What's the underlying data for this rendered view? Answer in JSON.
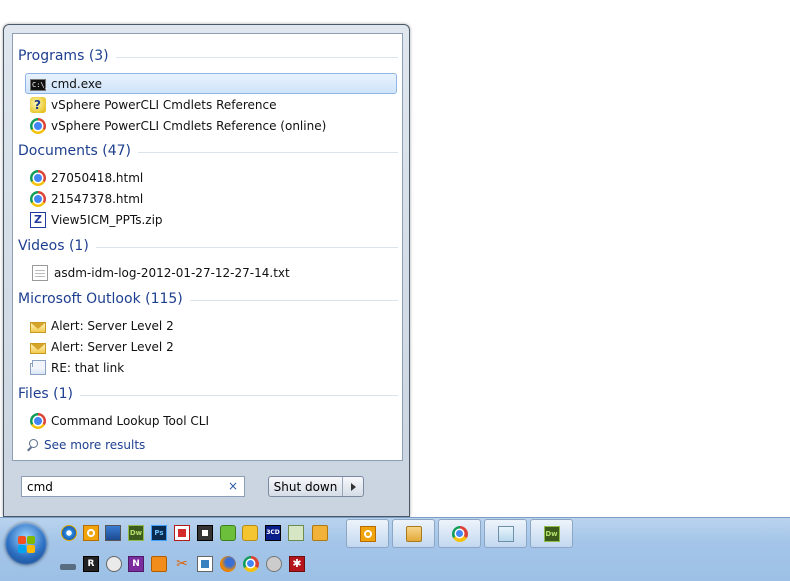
{
  "startmenu": {
    "groups": [
      {
        "title": "Programs (3)",
        "items": [
          {
            "label": "cmd.exe",
            "icon": "cmd-icon",
            "selected": true
          },
          {
            "label": "vSphere PowerCLI Cmdlets Reference",
            "icon": "help-file-icon"
          },
          {
            "label": "vSphere PowerCLI Cmdlets Reference (online)",
            "icon": "chrome-icon"
          }
        ]
      },
      {
        "title": "Documents (47)",
        "items": [
          {
            "label": "27050418.html",
            "icon": "chrome-icon"
          },
          {
            "label": "21547378.html",
            "icon": "chrome-icon"
          },
          {
            "label": "View5ICM_PPTs.zip",
            "icon": "zip-icon"
          }
        ]
      },
      {
        "title": "Videos (1)",
        "items": [
          {
            "label": "asdm-idm-log-2012-01-27-12-27-14.txt",
            "icon": "text-file-icon"
          }
        ]
      },
      {
        "title": "Microsoft Outlook (115)",
        "items": [
          {
            "label": "Alert: Server Level 2",
            "icon": "mail-icon"
          },
          {
            "label": "Alert: Server Level 2",
            "icon": "mail-icon"
          },
          {
            "label": "RE: that link",
            "icon": "mail-open-icon"
          }
        ]
      },
      {
        "title": "Files (1)",
        "items": [
          {
            "label": "Command Lookup Tool CLI",
            "icon": "chrome-icon"
          }
        ]
      }
    ],
    "see_more": "See more results",
    "search": {
      "value": "cmd",
      "clear": "×"
    },
    "shutdown_label": "Shut down"
  },
  "taskbar": {
    "quicklaunch_row1": [
      "internet-explorer-icon",
      "outlook-icon",
      "monitor-icon",
      "dreamweaver-icon",
      "photoshop-icon",
      "pdf-icon",
      "app-icon",
      "green-app-icon",
      "yellow-app-icon",
      "3cd-icon",
      "pen-icon",
      "folder-icon"
    ],
    "quicklaunch_row2": [
      "drive-icon",
      "r-app-icon",
      "gear-icon",
      "onenote-icon",
      "orange-app-icon",
      "scissors-icon",
      "vm-icon",
      "firefox-icon",
      "chrome-icon",
      "network-icon",
      "red-star-icon"
    ],
    "ql_text": {
      "dw": "Dw",
      "ps": "Ps",
      "3cd": "3CD",
      "r": "R",
      "onenote": "N",
      "star": "✱"
    },
    "buttons": [
      "outlook-icon",
      "explorer-folder-icon",
      "chrome-icon",
      "notepad-icon",
      "dreamweaver-icon"
    ]
  }
}
